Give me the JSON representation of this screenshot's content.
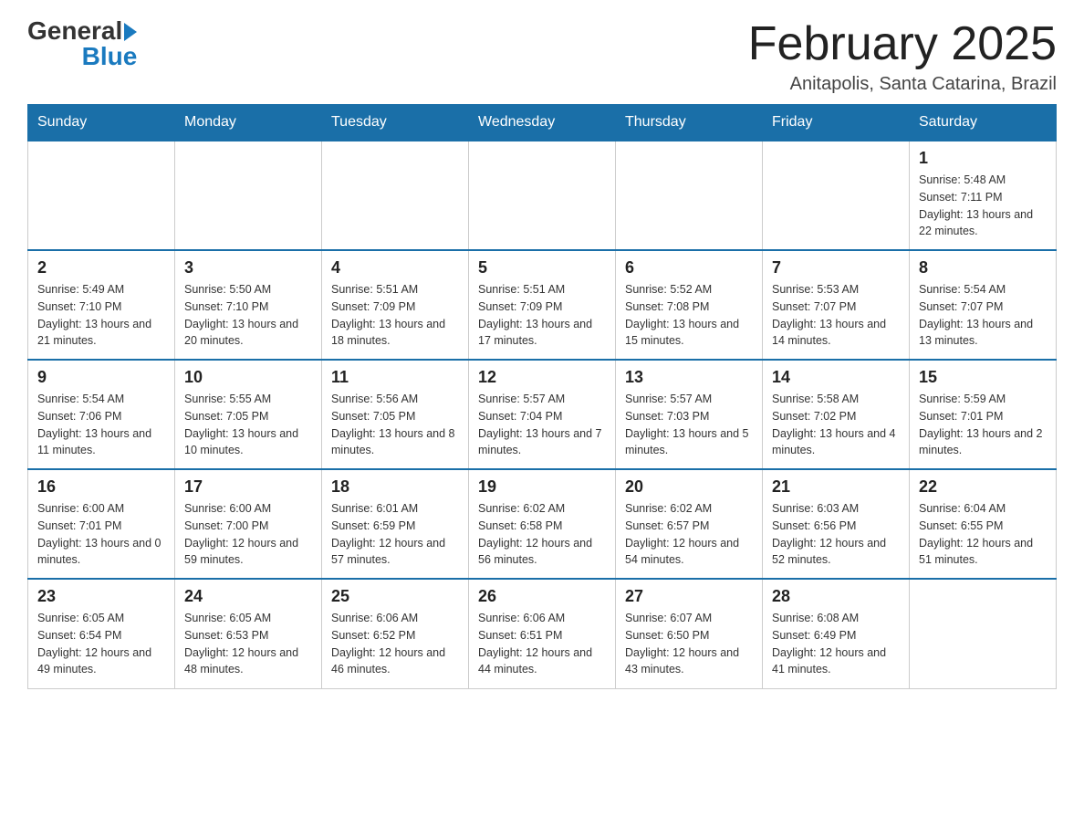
{
  "logo": {
    "general": "General",
    "arrow": "▶",
    "blue": "Blue"
  },
  "header": {
    "title": "February 2025",
    "subtitle": "Anitapolis, Santa Catarina, Brazil"
  },
  "weekdays": [
    "Sunday",
    "Monday",
    "Tuesday",
    "Wednesday",
    "Thursday",
    "Friday",
    "Saturday"
  ],
  "weeks": [
    [
      {
        "day": "",
        "info": ""
      },
      {
        "day": "",
        "info": ""
      },
      {
        "day": "",
        "info": ""
      },
      {
        "day": "",
        "info": ""
      },
      {
        "day": "",
        "info": ""
      },
      {
        "day": "",
        "info": ""
      },
      {
        "day": "1",
        "info": "Sunrise: 5:48 AM\nSunset: 7:11 PM\nDaylight: 13 hours and 22 minutes."
      }
    ],
    [
      {
        "day": "2",
        "info": "Sunrise: 5:49 AM\nSunset: 7:10 PM\nDaylight: 13 hours and 21 minutes."
      },
      {
        "day": "3",
        "info": "Sunrise: 5:50 AM\nSunset: 7:10 PM\nDaylight: 13 hours and 20 minutes."
      },
      {
        "day": "4",
        "info": "Sunrise: 5:51 AM\nSunset: 7:09 PM\nDaylight: 13 hours and 18 minutes."
      },
      {
        "day": "5",
        "info": "Sunrise: 5:51 AM\nSunset: 7:09 PM\nDaylight: 13 hours and 17 minutes."
      },
      {
        "day": "6",
        "info": "Sunrise: 5:52 AM\nSunset: 7:08 PM\nDaylight: 13 hours and 15 minutes."
      },
      {
        "day": "7",
        "info": "Sunrise: 5:53 AM\nSunset: 7:07 PM\nDaylight: 13 hours and 14 minutes."
      },
      {
        "day": "8",
        "info": "Sunrise: 5:54 AM\nSunset: 7:07 PM\nDaylight: 13 hours and 13 minutes."
      }
    ],
    [
      {
        "day": "9",
        "info": "Sunrise: 5:54 AM\nSunset: 7:06 PM\nDaylight: 13 hours and 11 minutes."
      },
      {
        "day": "10",
        "info": "Sunrise: 5:55 AM\nSunset: 7:05 PM\nDaylight: 13 hours and 10 minutes."
      },
      {
        "day": "11",
        "info": "Sunrise: 5:56 AM\nSunset: 7:05 PM\nDaylight: 13 hours and 8 minutes."
      },
      {
        "day": "12",
        "info": "Sunrise: 5:57 AM\nSunset: 7:04 PM\nDaylight: 13 hours and 7 minutes."
      },
      {
        "day": "13",
        "info": "Sunrise: 5:57 AM\nSunset: 7:03 PM\nDaylight: 13 hours and 5 minutes."
      },
      {
        "day": "14",
        "info": "Sunrise: 5:58 AM\nSunset: 7:02 PM\nDaylight: 13 hours and 4 minutes."
      },
      {
        "day": "15",
        "info": "Sunrise: 5:59 AM\nSunset: 7:01 PM\nDaylight: 13 hours and 2 minutes."
      }
    ],
    [
      {
        "day": "16",
        "info": "Sunrise: 6:00 AM\nSunset: 7:01 PM\nDaylight: 13 hours and 0 minutes."
      },
      {
        "day": "17",
        "info": "Sunrise: 6:00 AM\nSunset: 7:00 PM\nDaylight: 12 hours and 59 minutes."
      },
      {
        "day": "18",
        "info": "Sunrise: 6:01 AM\nSunset: 6:59 PM\nDaylight: 12 hours and 57 minutes."
      },
      {
        "day": "19",
        "info": "Sunrise: 6:02 AM\nSunset: 6:58 PM\nDaylight: 12 hours and 56 minutes."
      },
      {
        "day": "20",
        "info": "Sunrise: 6:02 AM\nSunset: 6:57 PM\nDaylight: 12 hours and 54 minutes."
      },
      {
        "day": "21",
        "info": "Sunrise: 6:03 AM\nSunset: 6:56 PM\nDaylight: 12 hours and 52 minutes."
      },
      {
        "day": "22",
        "info": "Sunrise: 6:04 AM\nSunset: 6:55 PM\nDaylight: 12 hours and 51 minutes."
      }
    ],
    [
      {
        "day": "23",
        "info": "Sunrise: 6:05 AM\nSunset: 6:54 PM\nDaylight: 12 hours and 49 minutes."
      },
      {
        "day": "24",
        "info": "Sunrise: 6:05 AM\nSunset: 6:53 PM\nDaylight: 12 hours and 48 minutes."
      },
      {
        "day": "25",
        "info": "Sunrise: 6:06 AM\nSunset: 6:52 PM\nDaylight: 12 hours and 46 minutes."
      },
      {
        "day": "26",
        "info": "Sunrise: 6:06 AM\nSunset: 6:51 PM\nDaylight: 12 hours and 44 minutes."
      },
      {
        "day": "27",
        "info": "Sunrise: 6:07 AM\nSunset: 6:50 PM\nDaylight: 12 hours and 43 minutes."
      },
      {
        "day": "28",
        "info": "Sunrise: 6:08 AM\nSunset: 6:49 PM\nDaylight: 12 hours and 41 minutes."
      },
      {
        "day": "",
        "info": ""
      }
    ]
  ]
}
